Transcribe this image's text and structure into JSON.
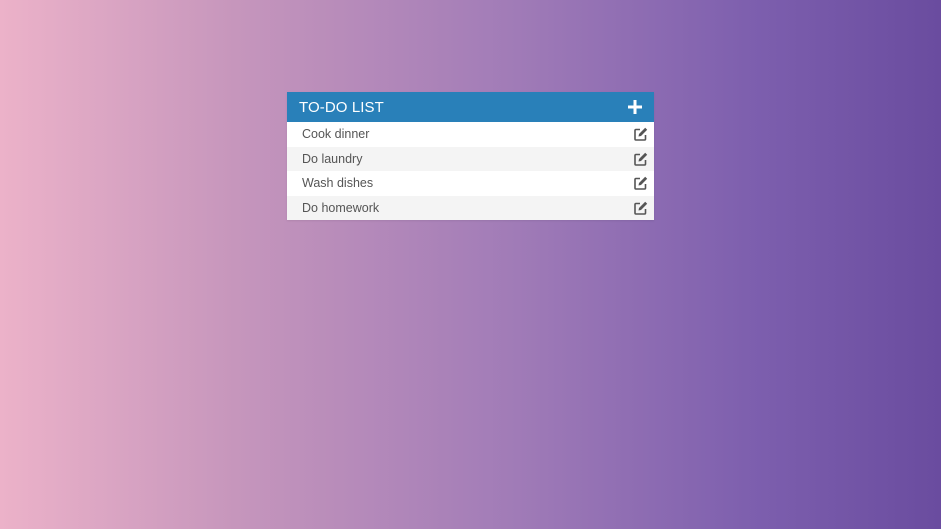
{
  "colors": {
    "header_bg": "#2980b9",
    "header_text": "#ffffff",
    "item_text": "#555555",
    "row_alt": "#f4f4f4",
    "row": "#ffffff"
  },
  "todo": {
    "title": "TO-DO LIST",
    "add_icon": "plus-icon",
    "edit_icon": "edit-icon",
    "items": [
      {
        "label": "Cook dinner"
      },
      {
        "label": "Do laundry"
      },
      {
        "label": "Wash dishes"
      },
      {
        "label": "Do homework"
      }
    ]
  }
}
